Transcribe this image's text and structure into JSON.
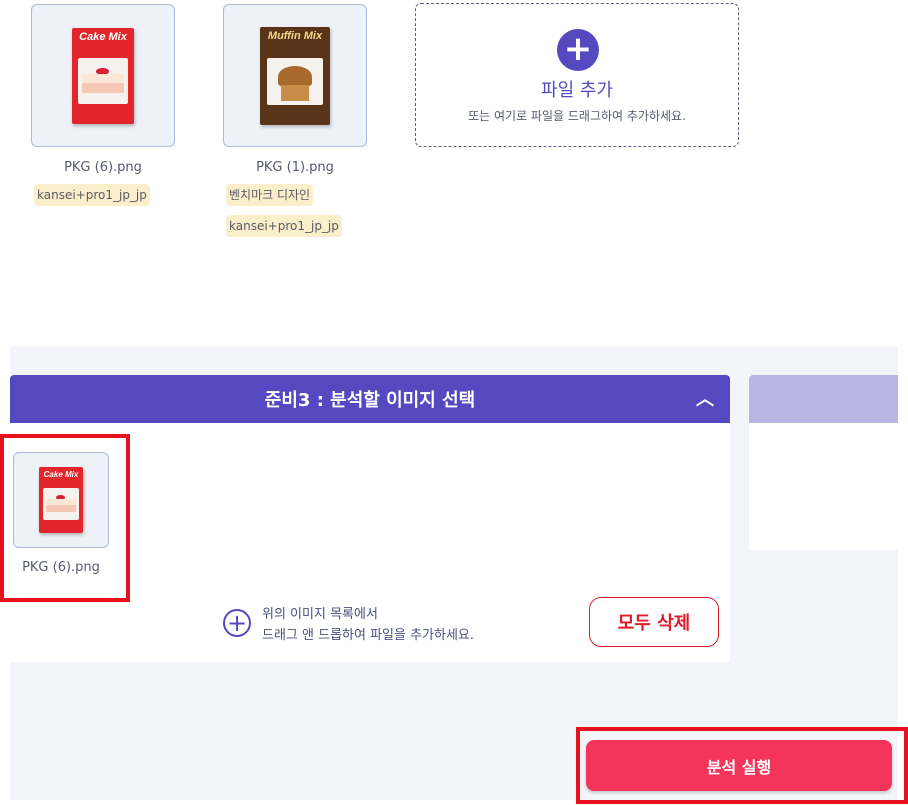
{
  "files": [
    {
      "name": "PKG (6).png",
      "box_title": "Cake Mix",
      "tags": [
        "kansei+pro1_jp_jp"
      ]
    },
    {
      "name": "PKG (1).png",
      "box_title": "Muffin Mix",
      "tags": [
        "벤치마크 디자인",
        "kansei+pro1_jp_jp"
      ]
    }
  ],
  "upload": {
    "title": "파일 추가",
    "subtitle": "또는 여기로 파일을 드래그하여 추가하세요.",
    "plus_glyph": "+"
  },
  "step3": {
    "title": "준비3 : 분석할 이미지 선택",
    "collapse_glyph": "︿",
    "selected": [
      {
        "name": "PKG (6).png",
        "box_title": "Cake Mix"
      }
    ],
    "drop_hint_line1": "위의 이미지 목록에서",
    "drop_hint_line2": "드래그 앤 드롭하여 파일을 추가하세요.",
    "drop_plus_glyph": "+",
    "clear_all_label": "모두 삭제"
  },
  "run_label": "분석 실행",
  "colors": {
    "accent": "#5549c0",
    "accent_light": "#b9b5e4",
    "danger": "#e01b28",
    "run_button": "#f4345b",
    "tag_bg": "#fbeecb"
  }
}
